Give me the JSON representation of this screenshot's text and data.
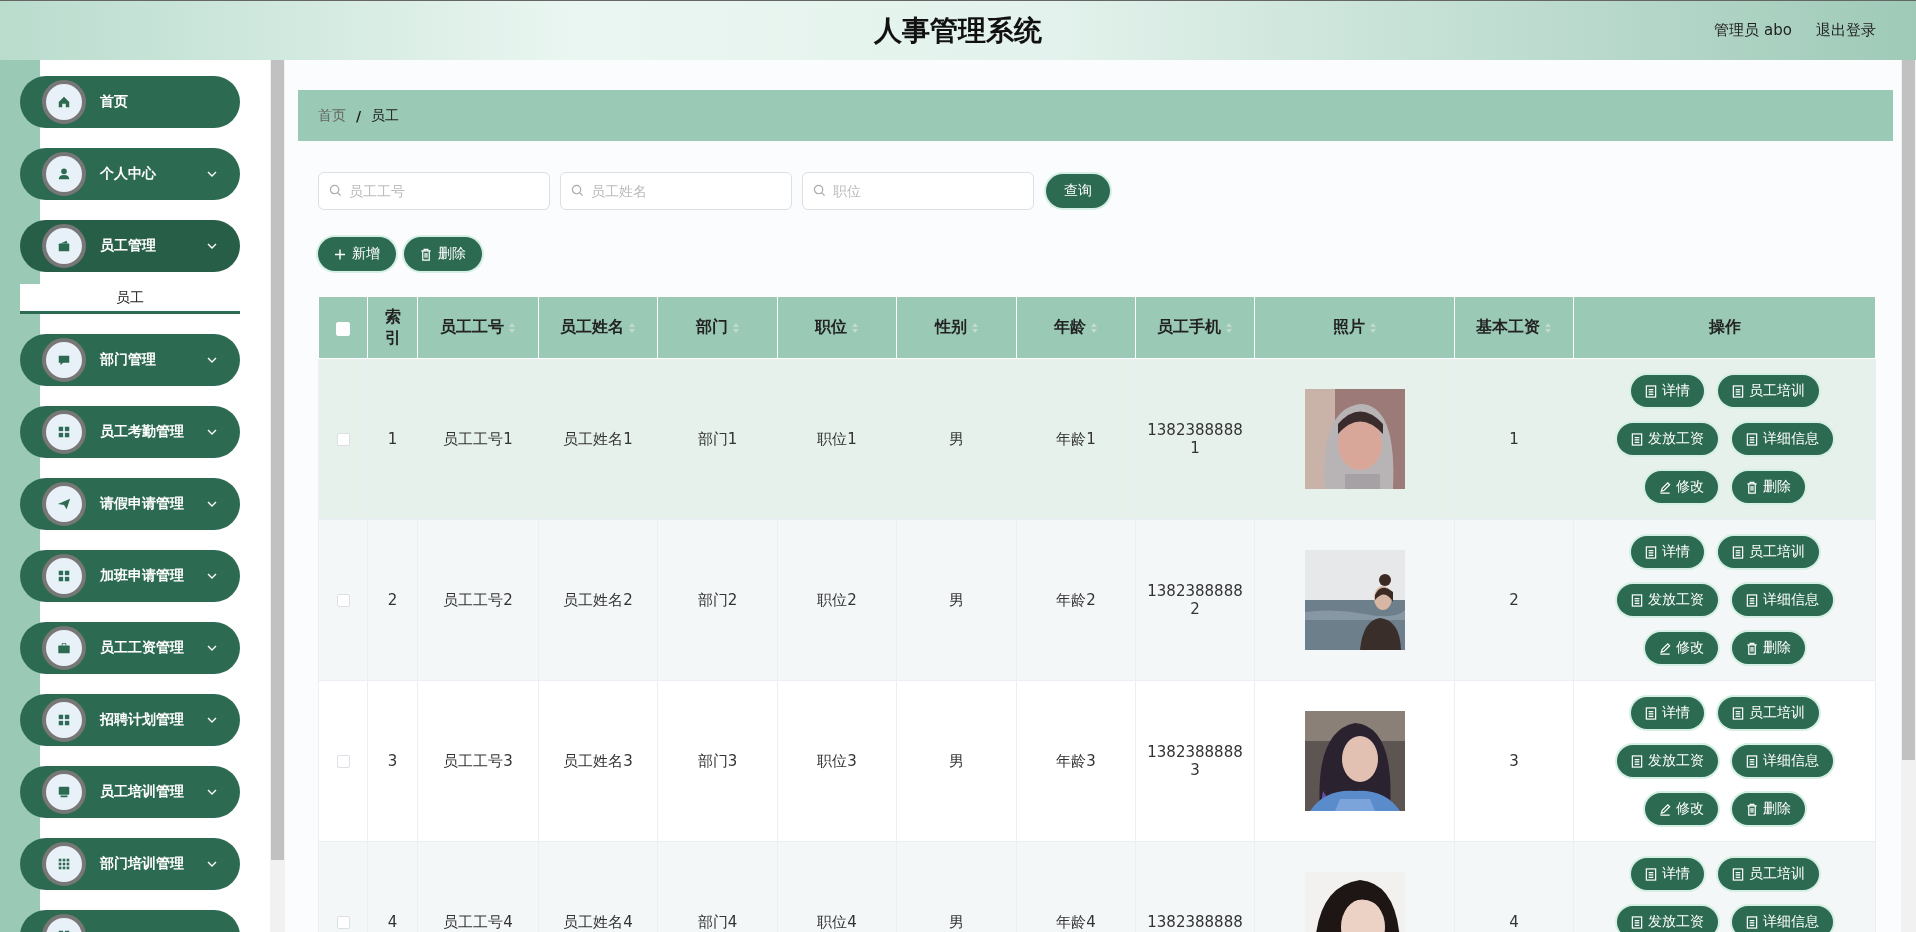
{
  "header": {
    "title": "人事管理系统",
    "user": "管理员 abo",
    "logout": "退出登录"
  },
  "menu": [
    {
      "label": "首页",
      "expandable": false,
      "expanded": false
    },
    {
      "label": "个人中心",
      "expandable": true,
      "expanded": false
    },
    {
      "label": "员工管理",
      "expandable": true,
      "expanded": true,
      "children": [
        {
          "label": "员工",
          "selected": true
        }
      ]
    },
    {
      "label": "部门管理",
      "expandable": true,
      "expanded": false
    },
    {
      "label": "员工考勤管理",
      "expandable": true,
      "expanded": false
    },
    {
      "label": "请假申请管理",
      "expandable": true,
      "expanded": false
    },
    {
      "label": "加班申请管理",
      "expandable": true,
      "expanded": false
    },
    {
      "label": "员工工资管理",
      "expandable": true,
      "expanded": false
    },
    {
      "label": "招聘计划管理",
      "expandable": true,
      "expanded": false
    },
    {
      "label": "员工培训管理",
      "expandable": true,
      "expanded": false
    },
    {
      "label": "部门培训管理",
      "expandable": true,
      "expanded": false
    },
    {
      "expanded": false
    }
  ],
  "breadcrumb": {
    "items": [
      "首页",
      "员工"
    ],
    "separator": "/"
  },
  "search": [
    {
      "placeholder": "员工工号"
    },
    {
      "placeholder": "员工姓名"
    },
    {
      "placeholder": "职位"
    }
  ],
  "search_button": "查询",
  "toolbar": [
    "新增",
    "删除"
  ],
  "table": {
    "select_all_checked": false,
    "columns": [
      {
        "label": "索引",
        "sortable": false
      },
      {
        "label": "员工工号",
        "sortable": true
      },
      {
        "label": "员工姓名",
        "sortable": true
      },
      {
        "label": "部门",
        "sortable": true
      },
      {
        "label": "职位",
        "sortable": true
      },
      {
        "label": "性别",
        "sortable": true
      },
      {
        "label": "年龄",
        "sortable": true
      },
      {
        "label": "员工手机",
        "sortable": true
      },
      {
        "label": "照片",
        "sortable": true
      },
      {
        "label": "基本工资",
        "sortable": true
      },
      {
        "label": "操作",
        "sortable": false
      }
    ],
    "rows": [
      {
        "checked": false,
        "highlighted": true,
        "cells": [
          "1",
          "员工工号1",
          "员工姓名1",
          "部门1",
          "职位1",
          "男",
          "年龄1",
          "13823888881"
        ],
        "salary": "1",
        "actions": [
          "详情",
          "员工培训",
          "发放工资",
          "详细信息",
          "修改",
          "删除"
        ]
      },
      {
        "checked": false,
        "highlighted": false,
        "cells": [
          "2",
          "员工工号2",
          "员工姓名2",
          "部门2",
          "职位2",
          "男",
          "年龄2",
          "13823888882"
        ],
        "salary": "2",
        "actions": [
          "详情",
          "员工培训",
          "发放工资",
          "详细信息",
          "修改",
          "删除"
        ]
      },
      {
        "checked": false,
        "highlighted": false,
        "cells": [
          "3",
          "员工工号3",
          "员工姓名3",
          "部门3",
          "职位3",
          "男",
          "年龄3",
          "13823888883"
        ],
        "salary": "3",
        "actions": [
          "详情",
          "员工培训",
          "发放工资",
          "详细信息",
          "修改",
          "删除"
        ]
      },
      {
        "checked": false,
        "highlighted": false,
        "cells": [
          "4",
          "员工工号4",
          "员工姓名4",
          "部门4",
          "职位4",
          "男",
          "年龄4",
          "1382388888"
        ],
        "salary": "4",
        "actions": [
          "详情",
          "员工培训",
          "发放工资",
          "详细信息"
        ]
      }
    ]
  }
}
